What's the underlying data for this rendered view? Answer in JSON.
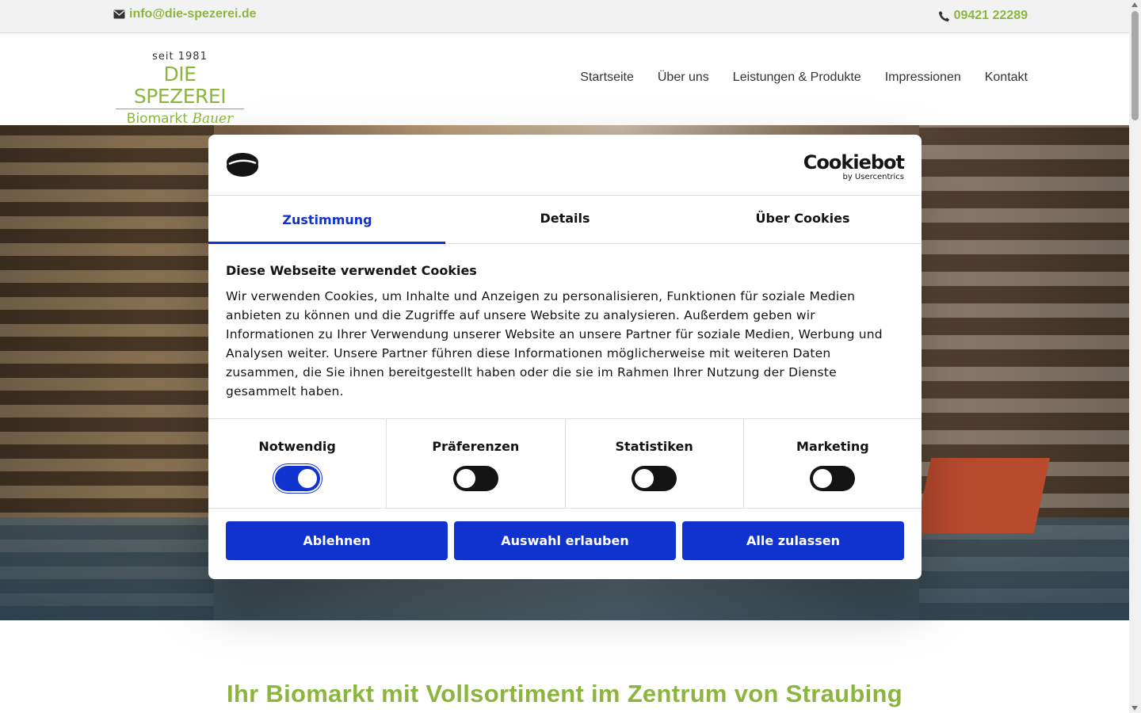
{
  "topbar": {
    "email": "info@die-spezerei.de",
    "email_icon": "envelope-icon",
    "phone": "09421 22289",
    "phone_icon": "phone-icon"
  },
  "logo": {
    "seit": "seit 1981",
    "name": "DIE SPEZEREI",
    "sub_left": "Biomarkt",
    "sub_right": "Bauer"
  },
  "nav": [
    "Startseite",
    "Über uns",
    "Leistungen & Produkte",
    "Impressionen",
    "Kontakt"
  ],
  "headline": "Ihr Biomarkt mit Vollsortiment im Zentrum von Straubing",
  "cookie_dialog": {
    "brand": "Cookiebot",
    "brand_sub": "by Usercentrics",
    "tabs": [
      "Zustimmung",
      "Details",
      "Über Cookies"
    ],
    "active_tab": "Zustimmung",
    "title": "Diese Webseite verwendet Cookies",
    "text": "Wir verwenden Cookies, um Inhalte und Anzeigen zu personalisieren, Funktionen für soziale Medien anbieten zu können und die Zugriffe auf unsere Website zu analysieren. Außerdem geben wir Informationen zu Ihrer Verwendung unserer Website an unsere Partner für soziale Medien, Werbung und Analysen weiter. Unsere Partner führen diese Informationen möglicherweise mit weiteren Daten zusammen, die Sie ihnen bereitgestellt haben oder die sie im Rahmen Ihrer Nutzung der Dienste gesammelt haben.",
    "toggles": [
      {
        "label": "Notwendig",
        "on": true
      },
      {
        "label": "Präferenzen",
        "on": false
      },
      {
        "label": "Statistiken",
        "on": false
      },
      {
        "label": "Marketing",
        "on": false
      }
    ],
    "buttons": {
      "decline": "Ablehnen",
      "allow_selection": "Auswahl erlauben",
      "allow_all": "Alle zulassen"
    }
  },
  "colors": {
    "brand_green": "#8cb53f",
    "cookiebot_blue": "#1032cf"
  }
}
